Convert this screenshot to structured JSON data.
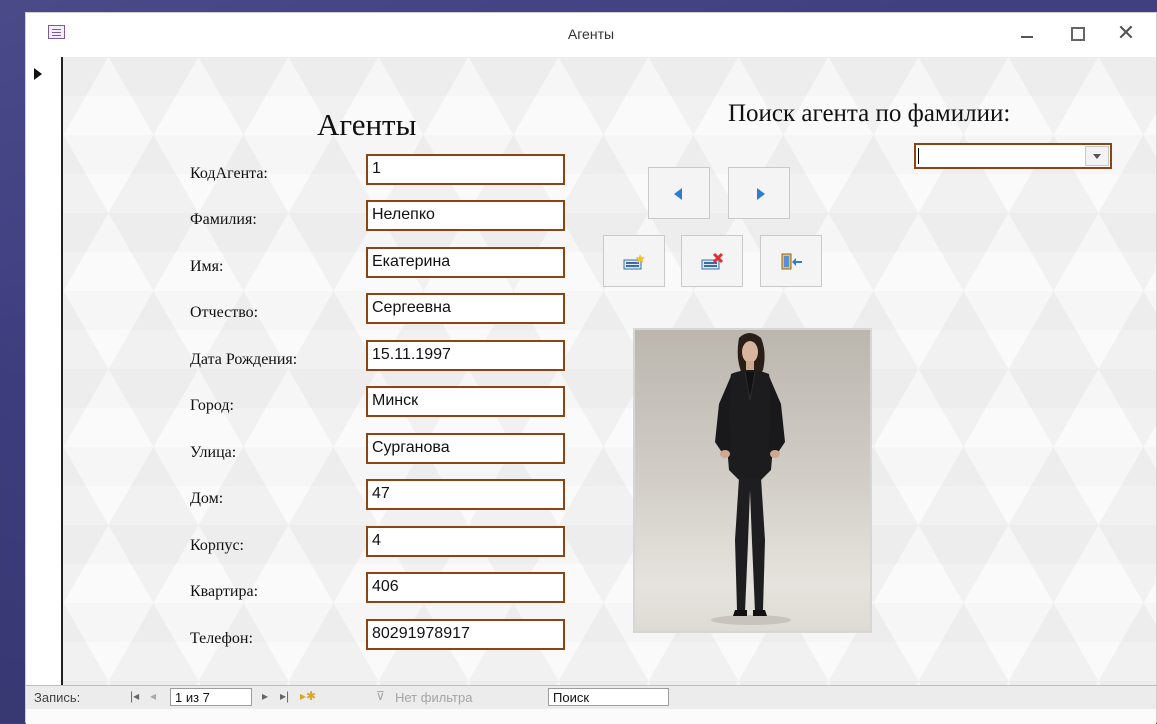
{
  "window": {
    "title": "Агенты"
  },
  "form": {
    "heading": "Агенты",
    "search_heading": "Поиск агента по фамилии:",
    "search_combo_value": "",
    "fields": [
      {
        "label": "КодАгента:",
        "value": "1"
      },
      {
        "label": "Фамилия:",
        "value": "Нелепко"
      },
      {
        "label": "Имя:",
        "value": "Екатерина"
      },
      {
        "label": "Отчество:",
        "value": "Сергеевна"
      },
      {
        "label": "Дата Рождения:",
        "value": "15.11.1997"
      },
      {
        "label": "Город:",
        "value": "Минск"
      },
      {
        "label": "Улица:",
        "value": "Сурганова"
      },
      {
        "label": "Дом:",
        "value": "47"
      },
      {
        "label": "Корпус:",
        "value": "4"
      },
      {
        "label": "Квартира:",
        "value": "406"
      },
      {
        "label": "Телефон:",
        "value": "80291978917"
      }
    ],
    "buttons": [
      {
        "name": "previous-record-button",
        "icon": "arrow-left-icon"
      },
      {
        "name": "next-record-button",
        "icon": "arrow-right-icon"
      },
      {
        "name": "new-record-button",
        "icon": "new-record-icon"
      },
      {
        "name": "delete-record-button",
        "icon": "delete-record-icon"
      },
      {
        "name": "close-form-button",
        "icon": "exit-door-icon"
      }
    ],
    "photo": {
      "icon": "agent-photo"
    }
  },
  "status_bar": {
    "record_label": "Запись:",
    "record_position": "1 из 7",
    "filter_label": "Нет фильтра",
    "search_label": "Поиск"
  },
  "colors": {
    "field_border": "#8b4513",
    "nav_arrow": "#2a7fd4",
    "background": "#3f3f82"
  }
}
